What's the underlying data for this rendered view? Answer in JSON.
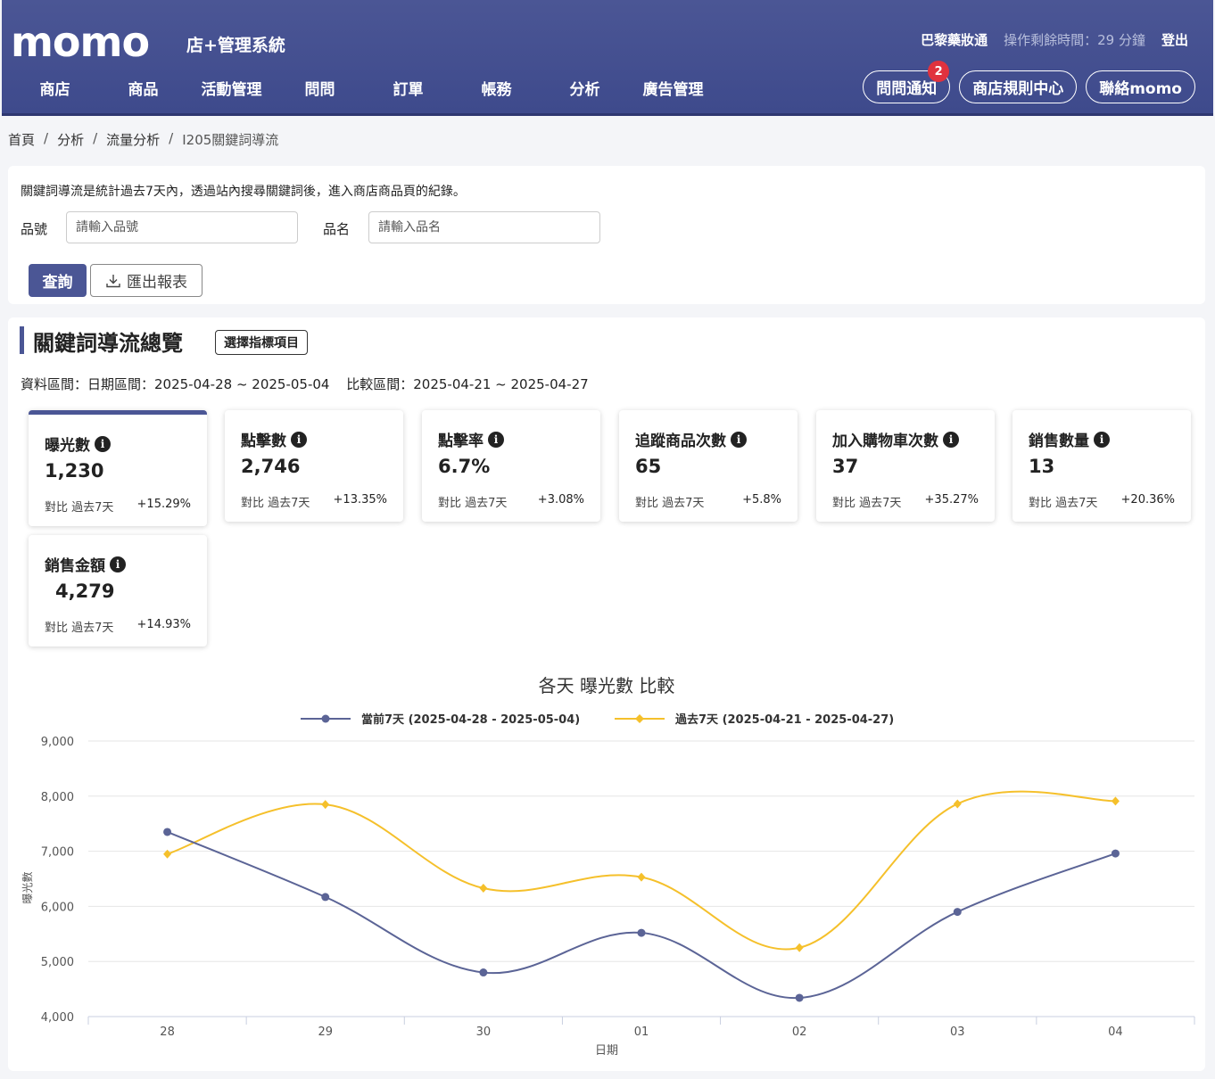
{
  "header": {
    "logo": "momo",
    "subtitle": "店+管理系統",
    "shop_name": "巴黎藥妝通",
    "timer": "操作剩餘時間：29 分鐘",
    "logout": "登出",
    "nav": [
      "商店",
      "商品",
      "活動管理",
      "問問",
      "訂單",
      "帳務",
      "分析",
      "廣告管理"
    ],
    "pills": {
      "notify": "問問通知",
      "notify_count": "2",
      "rules": "商店規則中心",
      "contact": "聯絡momo"
    }
  },
  "breadcrumb": [
    "首頁",
    "分析",
    "流量分析",
    "I205關鍵詞導流"
  ],
  "search": {
    "description": "關鍵詞導流是統計過去7天內，透過站內搜尋關鍵詞後，進入商店商品頁的紀錄。",
    "product_id_label": "品號",
    "product_id_placeholder": "請輸入品號",
    "product_name_label": "品名",
    "product_name_placeholder": "請輸入品名",
    "query_button": "查詢",
    "export_button": "匯出報表"
  },
  "overview": {
    "title": "關鍵詞導流總覽",
    "select_button": "選擇指標項目",
    "date_range": "資料區間：日期區間：2025-04-28 ~ 2025-05-04",
    "compare_range": "比較區間：2025-04-21 ~ 2025-04-27",
    "metrics": [
      {
        "label": "曝光數",
        "value": "1,230",
        "compare": "對比 過去7天",
        "pct": "+15.29%"
      },
      {
        "label": "點擊數",
        "value": "2,746",
        "compare": "對比 過去7天",
        "pct": "+13.35%"
      },
      {
        "label": "點擊率",
        "value": "6.7%",
        "compare": "對比 過去7天",
        "pct": "+3.08%"
      },
      {
        "label": "追蹤商品次數",
        "value": "65",
        "compare": "對比 過去7天",
        "pct": "+5.8%"
      },
      {
        "label": "加入購物車次數",
        "value": "37",
        "compare": "對比 過去7天",
        "pct": "+35.27%"
      },
      {
        "label": "銷售數量",
        "value": "13",
        "compare": "對比 過去7天",
        "pct": "+20.36%"
      },
      {
        "label": "銷售金額",
        "value": "4,279",
        "compare": "對比 過去7天",
        "pct": "+14.93%"
      }
    ]
  },
  "chart_data": {
    "type": "line",
    "title": "各天 曝光數 比較",
    "xlabel": "日期",
    "ylabel": "曝光數",
    "categories": [
      "28",
      "29",
      "30",
      "01",
      "02",
      "03",
      "04"
    ],
    "ylim": [
      4000,
      9000
    ],
    "yticks": [
      "4,000",
      "5,000",
      "6,000",
      "7,000",
      "8,000",
      "9,000"
    ],
    "legend": "top-center",
    "grid": true,
    "series": [
      {
        "name": "當前7天 (2025-04-28 - 2025-05-04)",
        "color": "#5b6496",
        "marker": "circle",
        "values": [
          7350,
          6170,
          4800,
          5520,
          4340,
          5900,
          6960
        ]
      },
      {
        "name": "過去7天 (2025-04-21 - 2025-04-27)",
        "color": "#f5c02b",
        "marker": "diamond",
        "values": [
          6950,
          7850,
          6330,
          6530,
          5250,
          7860,
          7910
        ]
      }
    ]
  }
}
